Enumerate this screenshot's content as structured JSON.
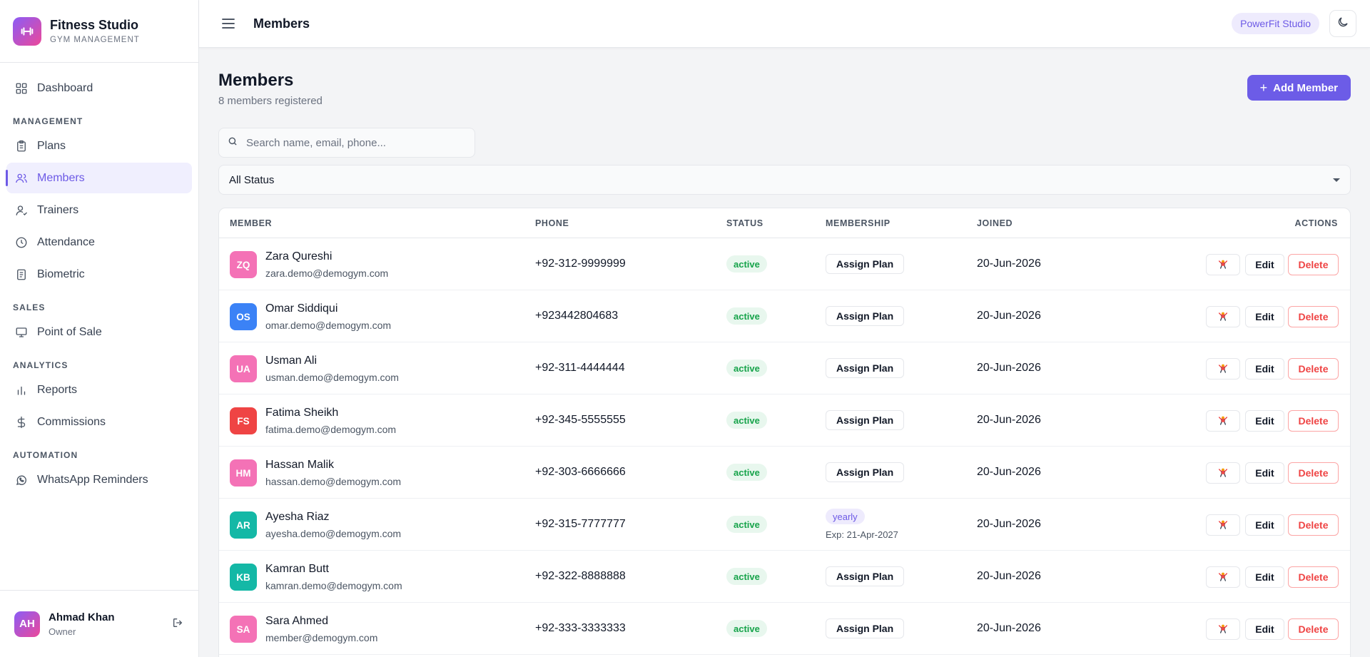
{
  "brand": {
    "title": "Fitness Studio",
    "subtitle": "GYM MANAGEMENT",
    "logo_icon": "dumbbell-icon",
    "gradient": [
      "#8b5cf6",
      "#ec4899"
    ]
  },
  "sidebar": {
    "dashboard": {
      "label": "Dashboard",
      "icon": "grid-icon"
    },
    "sections": {
      "management": "MANAGEMENT",
      "sales": "SALES",
      "analytics": "ANALYTICS",
      "automation": "AUTOMATION"
    },
    "items": {
      "plans": {
        "label": "Plans",
        "icon": "clipboard-icon"
      },
      "members": {
        "label": "Members",
        "icon": "users-icon",
        "active": true
      },
      "trainers": {
        "label": "Trainers",
        "icon": "user-icon"
      },
      "attendance": {
        "label": "Attendance",
        "icon": "clock-icon"
      },
      "biometric": {
        "label": "Biometric",
        "icon": "document-icon"
      },
      "pos": {
        "label": "Point of Sale",
        "icon": "monitor-icon"
      },
      "reports": {
        "label": "Reports",
        "icon": "bar-chart-icon"
      },
      "commissions": {
        "label": "Commissions",
        "icon": "dollar-icon"
      },
      "whatsapp": {
        "label": "WhatsApp Reminders",
        "icon": "whatsapp-icon"
      }
    },
    "user": {
      "initials": "AH",
      "name": "Ahmad Khan",
      "role": "Owner"
    }
  },
  "topbar": {
    "title": "Members",
    "studio": "PowerFit Studio"
  },
  "page": {
    "title": "Members",
    "subtitle": "8 members registered",
    "add_button": "Add Member",
    "search_placeholder": "Search name, email, phone...",
    "status_filter": "All Status"
  },
  "table": {
    "headers": {
      "member": "MEMBER",
      "phone": "PHONE",
      "status": "STATUS",
      "membership": "MEMBERSHIP",
      "joined": "JOINED",
      "actions": "ACTIONS"
    },
    "assign_label": "Assign Plan",
    "edit_label": "Edit",
    "delete_label": "Delete",
    "rows": [
      {
        "initials": "ZQ",
        "color": "#f472b6",
        "name": "Zara Qureshi",
        "email": "zara.demo@demogym.com",
        "phone": "+92-312-9999999",
        "status": "active",
        "joined": "20-Jun-2026"
      },
      {
        "initials": "OS",
        "color": "#3b82f6",
        "name": "Omar Siddiqui",
        "email": "omar.demo@demogym.com",
        "phone": "+923442804683",
        "status": "active",
        "joined": "20-Jun-2026"
      },
      {
        "initials": "UA",
        "color": "#f472b6",
        "name": "Usman Ali",
        "email": "usman.demo@demogym.com",
        "phone": "+92-311-4444444",
        "status": "active",
        "joined": "20-Jun-2026"
      },
      {
        "initials": "FS",
        "color": "#ef4444",
        "name": "Fatima Sheikh",
        "email": "fatima.demo@demogym.com",
        "phone": "+92-345-5555555",
        "status": "active",
        "joined": "20-Jun-2026"
      },
      {
        "initials": "HM",
        "color": "#f472b6",
        "name": "Hassan Malik",
        "email": "hassan.demo@demogym.com",
        "phone": "+92-303-6666666",
        "status": "active",
        "joined": "20-Jun-2026"
      },
      {
        "initials": "AR",
        "color": "#14b8a6",
        "name": "Ayesha Riaz",
        "email": "ayesha.demo@demogym.com",
        "phone": "+92-315-7777777",
        "status": "active",
        "plan": "yearly",
        "plan_exp": "Exp: 21-Apr-2027",
        "joined": "20-Jun-2026"
      },
      {
        "initials": "KB",
        "color": "#14b8a6",
        "name": "Kamran Butt",
        "email": "kamran.demo@demogym.com",
        "phone": "+92-322-8888888",
        "status": "active",
        "joined": "20-Jun-2026"
      },
      {
        "initials": "SA",
        "color": "#f472b6",
        "name": "Sara Ahmed",
        "email": "member@demogym.com",
        "phone": "+92-333-3333333",
        "status": "active",
        "joined": "20-Jun-2026"
      }
    ]
  },
  "colors": {
    "accent": "#6c5ce7",
    "active_bg": "#e8f7ee",
    "active_text": "#16a34a",
    "danger": "#ef4444"
  }
}
